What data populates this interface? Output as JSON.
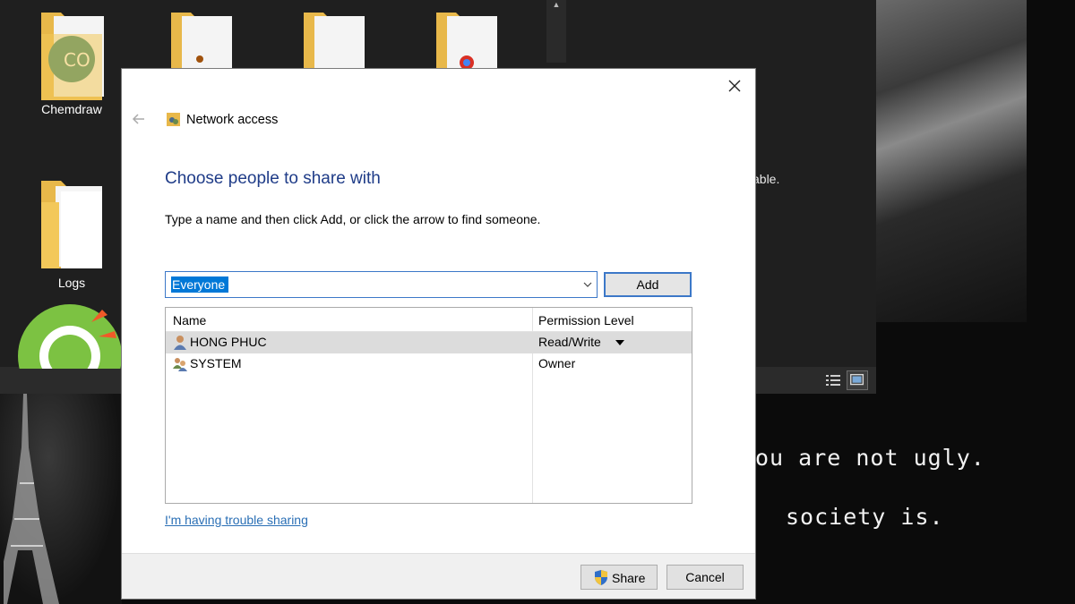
{
  "desktop": {
    "icons": [
      {
        "label": "Chemdraw",
        "icon": "chemdraw-folder"
      },
      {
        "label": "Logs",
        "icon": "folder"
      }
    ],
    "quote_line_1": "ou are not ugly.",
    "quote_line_2": "society is.",
    "partial_text": "able."
  },
  "dialog": {
    "title": "Network access",
    "heading": "Choose people to share with",
    "instruction": "Type a name and then click Add, or click the arrow to find someone.",
    "name_input": {
      "value": "Everyone"
    },
    "add_label": "Add",
    "columns": {
      "name": "Name",
      "permission": "Permission Level"
    },
    "rows": [
      {
        "name": "HONG PHUC",
        "permission": "Read/Write",
        "icon": "user-icon",
        "selected": true
      },
      {
        "name": "SYSTEM",
        "permission": "Owner",
        "icon": "group-users-icon",
        "selected": false
      }
    ],
    "trouble_link": "I'm having trouble sharing",
    "share_label": "Share",
    "cancel_label": "Cancel"
  },
  "colors": {
    "heading": "#1f3c88",
    "link": "#2a6fb5",
    "focus_border": "#3c78c8",
    "selection": "#0078d7"
  }
}
